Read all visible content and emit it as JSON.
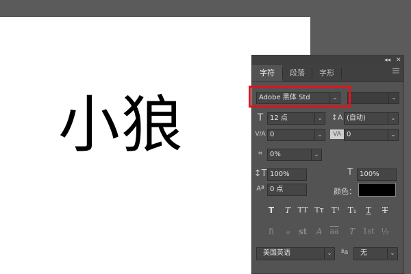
{
  "canvas": {
    "text": "小狼"
  },
  "panel": {
    "titlebar": {
      "collapse_icon": "◂◂",
      "close_icon": "✕"
    },
    "tabs": [
      {
        "label": "字符",
        "active": true
      },
      {
        "label": "段落",
        "active": false
      },
      {
        "label": "字形",
        "active": false
      }
    ],
    "font_family": "Adobe 黑体 Std",
    "font_size": "12 点",
    "leading": "(自动)",
    "kerning": "0",
    "tracking": "0",
    "tsume": "0%",
    "vertical_scale": "100%",
    "horizontal_scale": "100%",
    "baseline_shift": "0 点",
    "color_label": "颜色：",
    "text_color": "#000000",
    "style_buttons": [
      "T",
      "T",
      "TT",
      "Tт",
      "T¹",
      "T₁",
      "T",
      "T"
    ],
    "opentype_buttons": [
      "fi",
      "ℴ",
      "st",
      "A",
      "aa",
      "T",
      "1st",
      "½"
    ],
    "language": "美国英语",
    "anti_alias_label": "ªa",
    "anti_alias": "无"
  },
  "highlight_color": "#e3121a"
}
